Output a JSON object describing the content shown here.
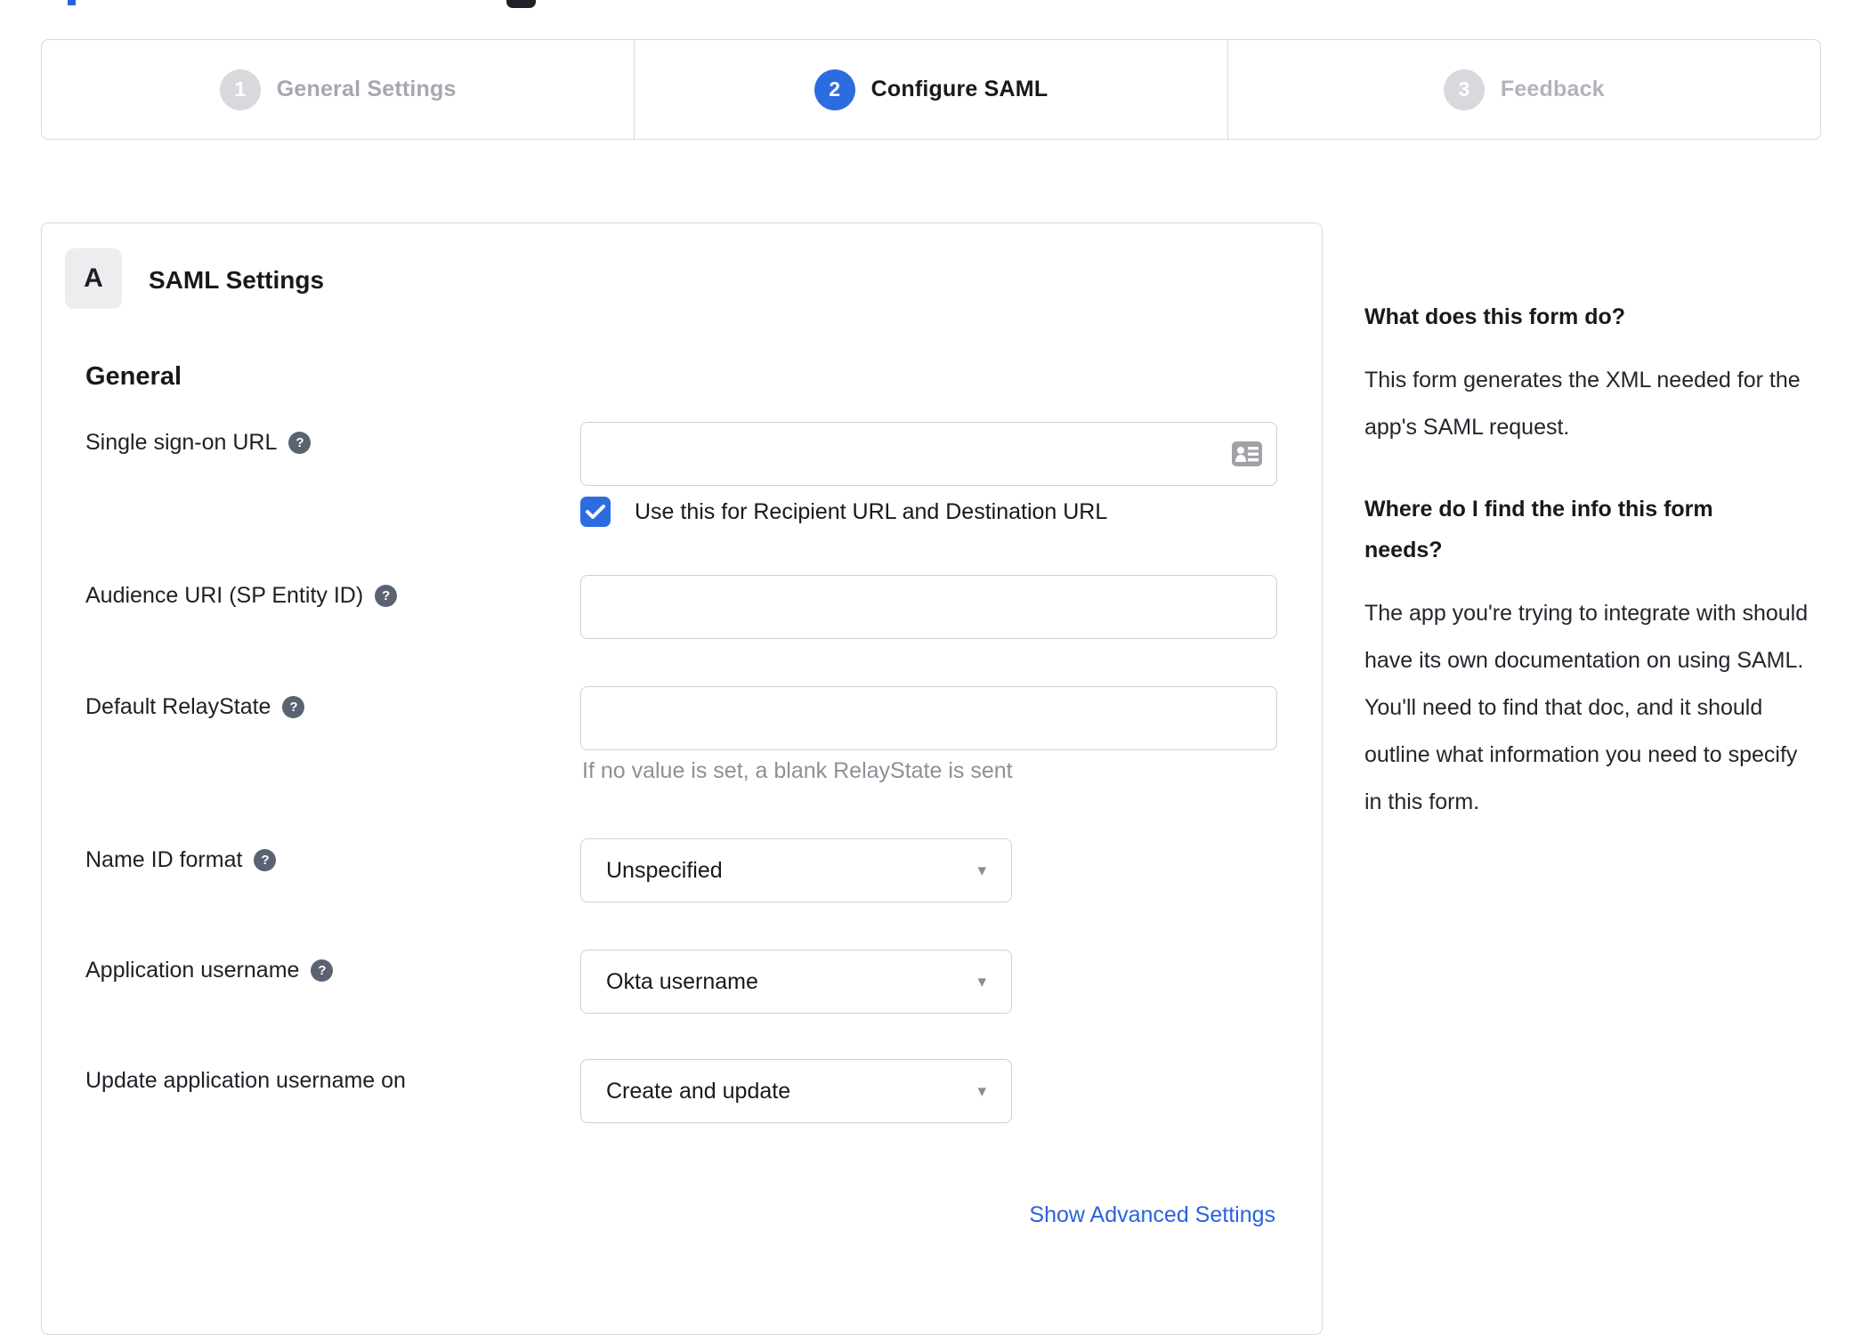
{
  "colors": {
    "accent_blue": "#2b6ce0",
    "link_blue": "#2b63df",
    "inactive_gray": "#d8d9dd",
    "border_gray": "#d8d9dd",
    "help_circle": "#5b6372"
  },
  "stepper": {
    "steps": [
      {
        "number": "1",
        "label": "General Settings",
        "state": "inactive"
      },
      {
        "number": "2",
        "label": "Configure SAML",
        "state": "active"
      },
      {
        "number": "3",
        "label": "Feedback",
        "state": "inactive"
      }
    ]
  },
  "panel": {
    "section_badge": "A",
    "section_title": "SAML Settings",
    "group_heading": "General",
    "fields": [
      {
        "label": "Single sign-on URL",
        "has_help": true,
        "type": "text",
        "value": ""
      },
      {
        "label": "Audience URI (SP Entity ID)",
        "has_help": true,
        "type": "text",
        "value": ""
      },
      {
        "label": "Default RelayState",
        "has_help": true,
        "type": "text",
        "value": "",
        "hint": "If no value is set, a blank RelayState is sent"
      },
      {
        "label": "Name ID format",
        "has_help": true,
        "type": "select",
        "value": "Unspecified"
      },
      {
        "label": "Application username",
        "has_help": true,
        "type": "select",
        "value": "Okta username"
      },
      {
        "label": "Update application username on",
        "has_help": false,
        "type": "select",
        "value": "Create and update"
      }
    ],
    "sso_checkbox": {
      "label": "Use this for Recipient URL and Destination URL",
      "checked": true
    },
    "advanced_link": "Show Advanced Settings"
  },
  "sidebar": {
    "heading1": "What does this form do?",
    "para1": "This form generates the XML needed for the app's SAML request.",
    "heading2": "Where do I find the info this form needs?",
    "para2": "The app you're trying to integrate with should have its own documentation on using SAML. You'll need to find that doc, and it should outline what information you need to specify in this form."
  },
  "icons": {
    "help_glyph": "?",
    "select_arrow": "▾"
  }
}
